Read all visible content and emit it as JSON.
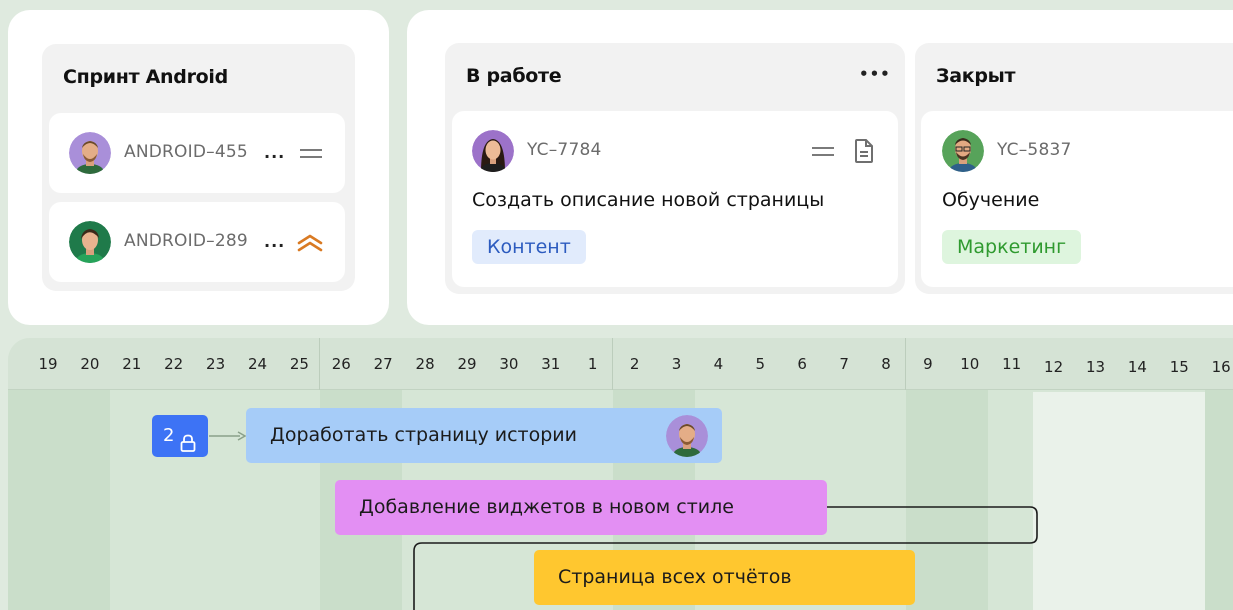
{
  "sprint": {
    "title": "Спринт Android",
    "items": [
      {
        "key": "ANDROID–455",
        "more": "...",
        "priority_icon": "equals-icon"
      },
      {
        "key": "ANDROID–289",
        "more": "...",
        "priority_icon": "chevrons-up-icon"
      }
    ]
  },
  "board": {
    "columns": [
      {
        "title": "В работе",
        "menu": "•••",
        "card": {
          "key": "YC–7784",
          "title": "Создать описание новой страницы",
          "tag": "Контент",
          "icons": [
            "equals-icon",
            "document-icon"
          ]
        }
      },
      {
        "title": "Закрыт",
        "card": {
          "key": "YC–5837",
          "title": "Обучение",
          "tag": "Маркетинг"
        }
      }
    ]
  },
  "timeline": {
    "days": [
      "19",
      "20",
      "21",
      "22",
      "23",
      "24",
      "25",
      "26",
      "27",
      "28",
      "29",
      "30",
      "31",
      "1",
      "2",
      "3",
      "4",
      "5",
      "6",
      "7",
      "8",
      "9",
      "10",
      "11",
      "12",
      "13",
      "14",
      "15",
      "16"
    ],
    "dependency_badge": "2",
    "bars": [
      {
        "label": "Доработать страницу истории",
        "color": "#a6ccf8"
      },
      {
        "label": "Добавление виджетов в новом стиле",
        "color": "#e38ff3"
      },
      {
        "label": "Страница всех отчётов",
        "color": "#ffc72f"
      }
    ]
  },
  "colors": {
    "tag_content_bg": "#e1ebfc",
    "tag_content_fg": "#2c5bbf",
    "tag_marketing_bg": "#def5de",
    "tag_marketing_fg": "#2f9a2f",
    "priority_high": "#d97a23",
    "badge": "#3d73f5"
  }
}
